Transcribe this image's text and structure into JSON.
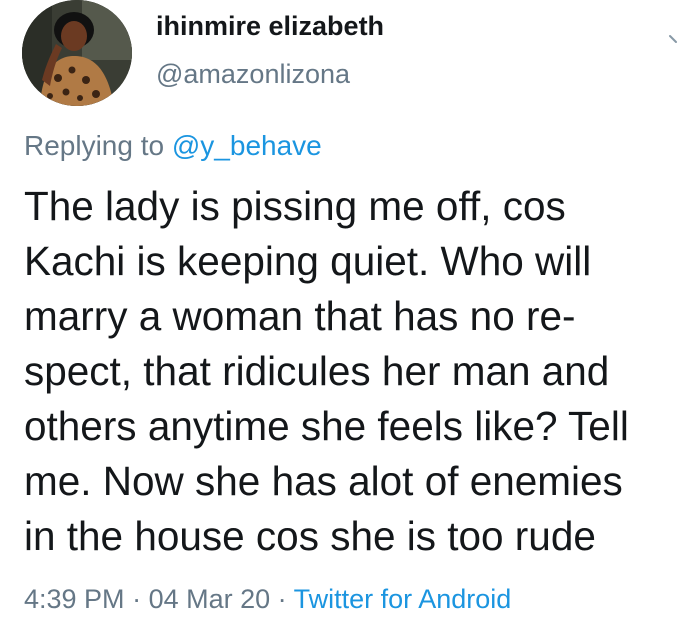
{
  "author": {
    "display_name": "ihinmire elizabeth",
    "handle": "@amazonlizona"
  },
  "reply": {
    "prefix": "Replying to ",
    "to_handle": "@y_behave"
  },
  "tweet": {
    "lines": [
      "The lady is pissing me off,  cos",
      "Kachi is keeping quiet. Who will",
      "marry a woman that has no re-",
      "spect,  that ridicules her man and",
      "others anytime she feels like?  Tell",
      "me. Now she has alot of enemies",
      "in the house cos she is  too rude"
    ]
  },
  "meta": {
    "time": "4:39 PM",
    "separator": " · ",
    "date": "04 Mar 20",
    "source": "Twitter for Android"
  },
  "icons": {
    "avatar": "profile-photo",
    "more": "chevron-down-icon"
  },
  "colors": {
    "text": "#14171a",
    "secondary": "#657786",
    "link": "#1b95e0"
  }
}
